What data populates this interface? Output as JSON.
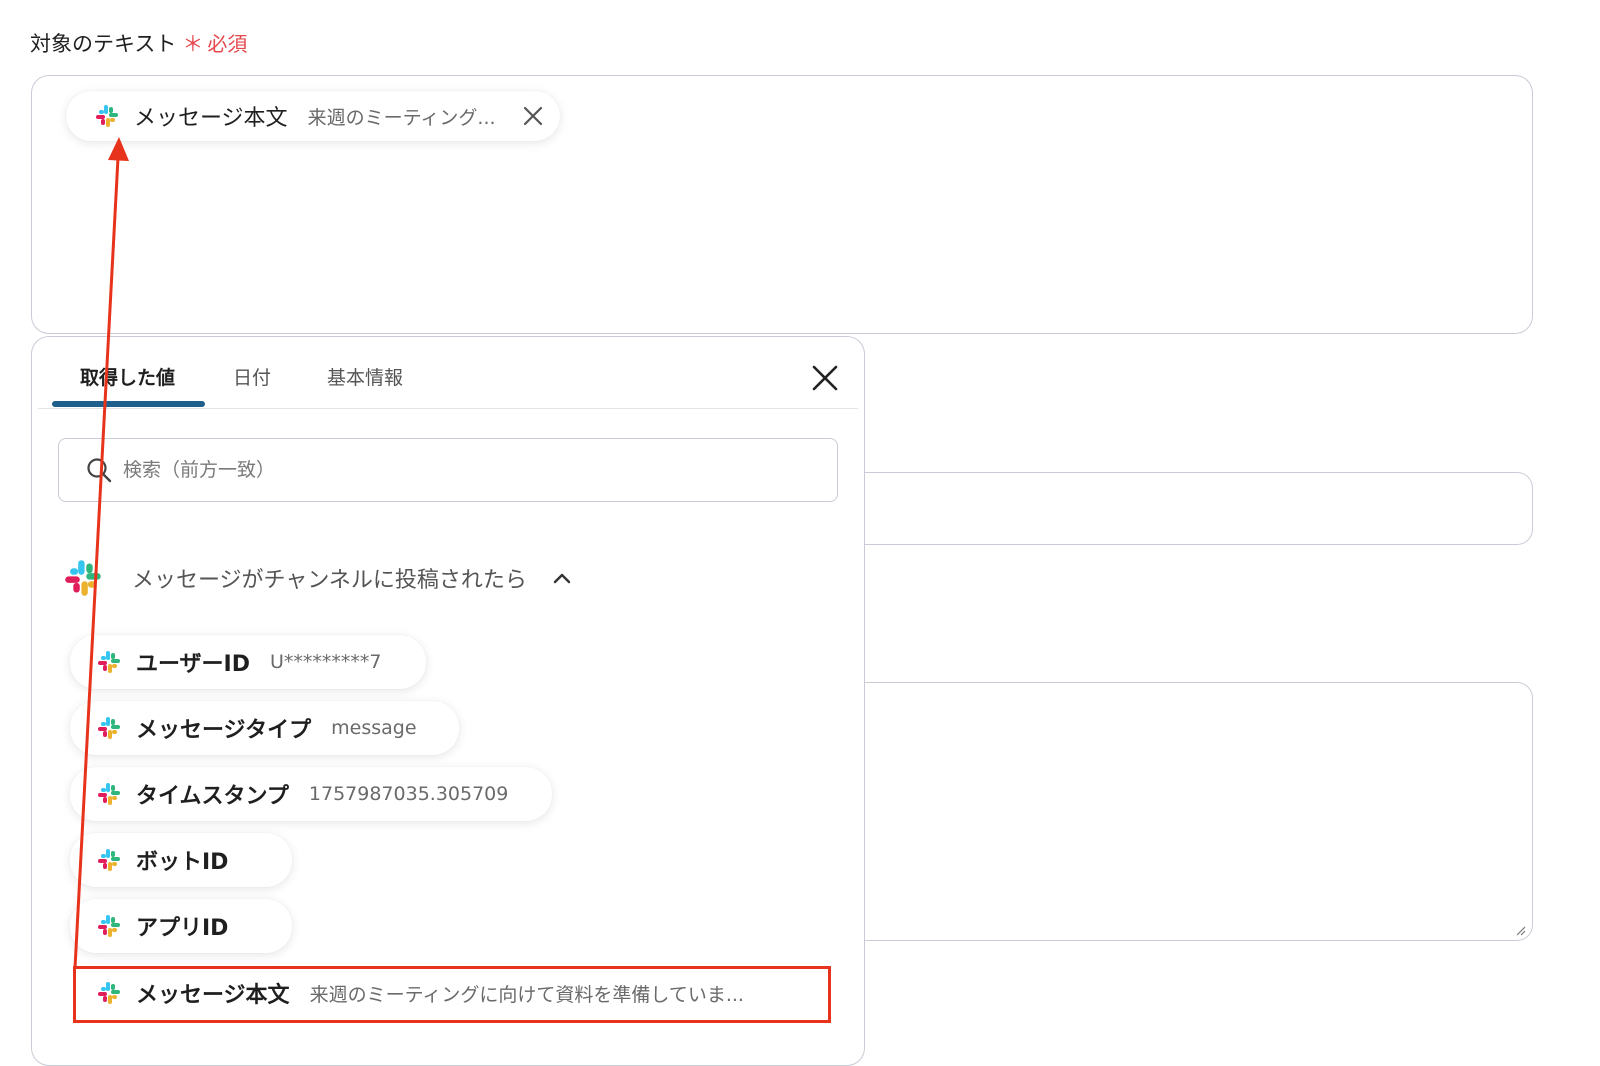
{
  "field": {
    "label": "対象のテキスト",
    "required_star": "＊",
    "required_text": "必須"
  },
  "selected_chip": {
    "key": "メッセージ本文",
    "value": "来週のミーティング..."
  },
  "popover": {
    "tabs": [
      {
        "label": "取得した値"
      },
      {
        "label": "日付"
      },
      {
        "label": "基本情報"
      }
    ],
    "search": {
      "placeholder": "検索（前方一致）"
    },
    "group": {
      "title": "メッセージがチャンネルに投稿されたら",
      "items": [
        {
          "key": "ユーザーID",
          "value": "U*********7"
        },
        {
          "key": "メッセージタイプ",
          "value": "message"
        },
        {
          "key": "タイムスタンプ",
          "value": "1757987035.305709"
        },
        {
          "key": "ボットID",
          "value": ""
        },
        {
          "key": "アプリID",
          "value": ""
        },
        {
          "key": "メッセージ本文",
          "value": "来週のミーティングに向けて資料を準備していま..."
        }
      ]
    }
  },
  "colors": {
    "required": "#e5484d",
    "tab_underline": "#1f5f8b",
    "annotation": "#e8331c",
    "slack_blue": "#36c5f0",
    "slack_green": "#2eb67d",
    "slack_yellow": "#ecb22e",
    "slack_red": "#e01e5a"
  },
  "icons": {
    "app": "slack-icon",
    "close": "close-icon",
    "search": "search-icon",
    "collapse": "chevron-up-icon"
  }
}
